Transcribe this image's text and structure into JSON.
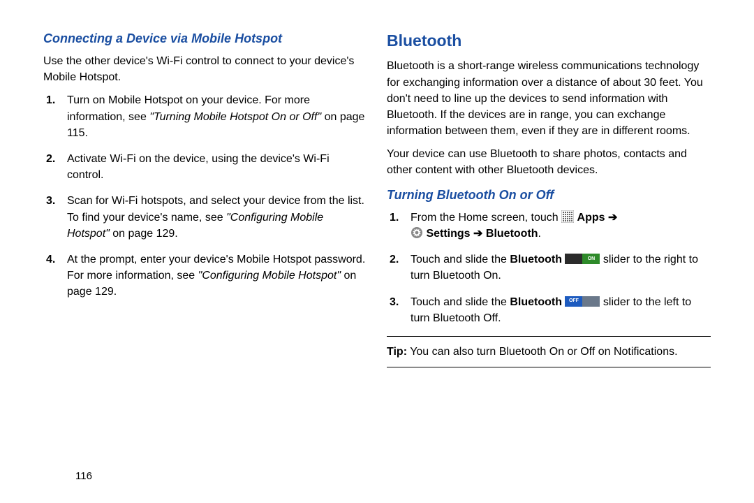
{
  "left": {
    "sub_heading": "Connecting a Device via Mobile Hotspot",
    "intro": "Use the other device's Wi-Fi control to connect to your device's Mobile Hotspot.",
    "s1_a": "Turn on Mobile Hotspot on your device. For more information, see",
    "s1_ref": "\"Turning Mobile Hotspot On or Off\"",
    "s1_b": "on page 115.",
    "s2": "Activate Wi-Fi on the device, using the device's Wi-Fi control.",
    "s3_a": "Scan for Wi-Fi hotspots, and select your device from the list. To find your device's name, see",
    "s3_ref": "\"Configuring Mobile Hotspot\"",
    "s3_b": "on page 129.",
    "s4_a": "At the prompt, enter your device's Mobile Hotspot password. For more information, see",
    "s4_ref": "\"Configuring Mobile Hotspot\"",
    "s4_b": "on page 129."
  },
  "right": {
    "main_heading": "Bluetooth",
    "para1": "Bluetooth is a short-range wireless communications technology for exchanging information over a distance of about 30 feet. You don't need to line up the devices to send information with Bluetooth. If the devices are in range, you can exchange information between them, even if they are in different rooms.",
    "para2": "Your device can use Bluetooth to share photos, contacts and other content with other Bluetooth devices.",
    "sub_heading": "Turning Bluetooth On or Off",
    "s1_a": "From the Home screen, touch",
    "s1_apps": "Apps",
    "s1_arrow1": "➔",
    "s1_settings": "Settings",
    "s1_arrow2": "➔",
    "s1_bt": "Bluetooth",
    "s1_period": ".",
    "s2_a": "Touch and slide the",
    "s2_bt": "Bluetooth",
    "s2_on_label": "ON",
    "s2_b": "slider to the right to turn Bluetooth On.",
    "s3_a": "Touch and slide the",
    "s3_bt": "Bluetooth",
    "s3_off_label": "OFF",
    "s3_b": "slider to the left to turn Bluetooth Off.",
    "tip_label": "Tip:",
    "tip_text": "You can also turn Bluetooth On or Off on Notifications."
  },
  "page_number": "116"
}
